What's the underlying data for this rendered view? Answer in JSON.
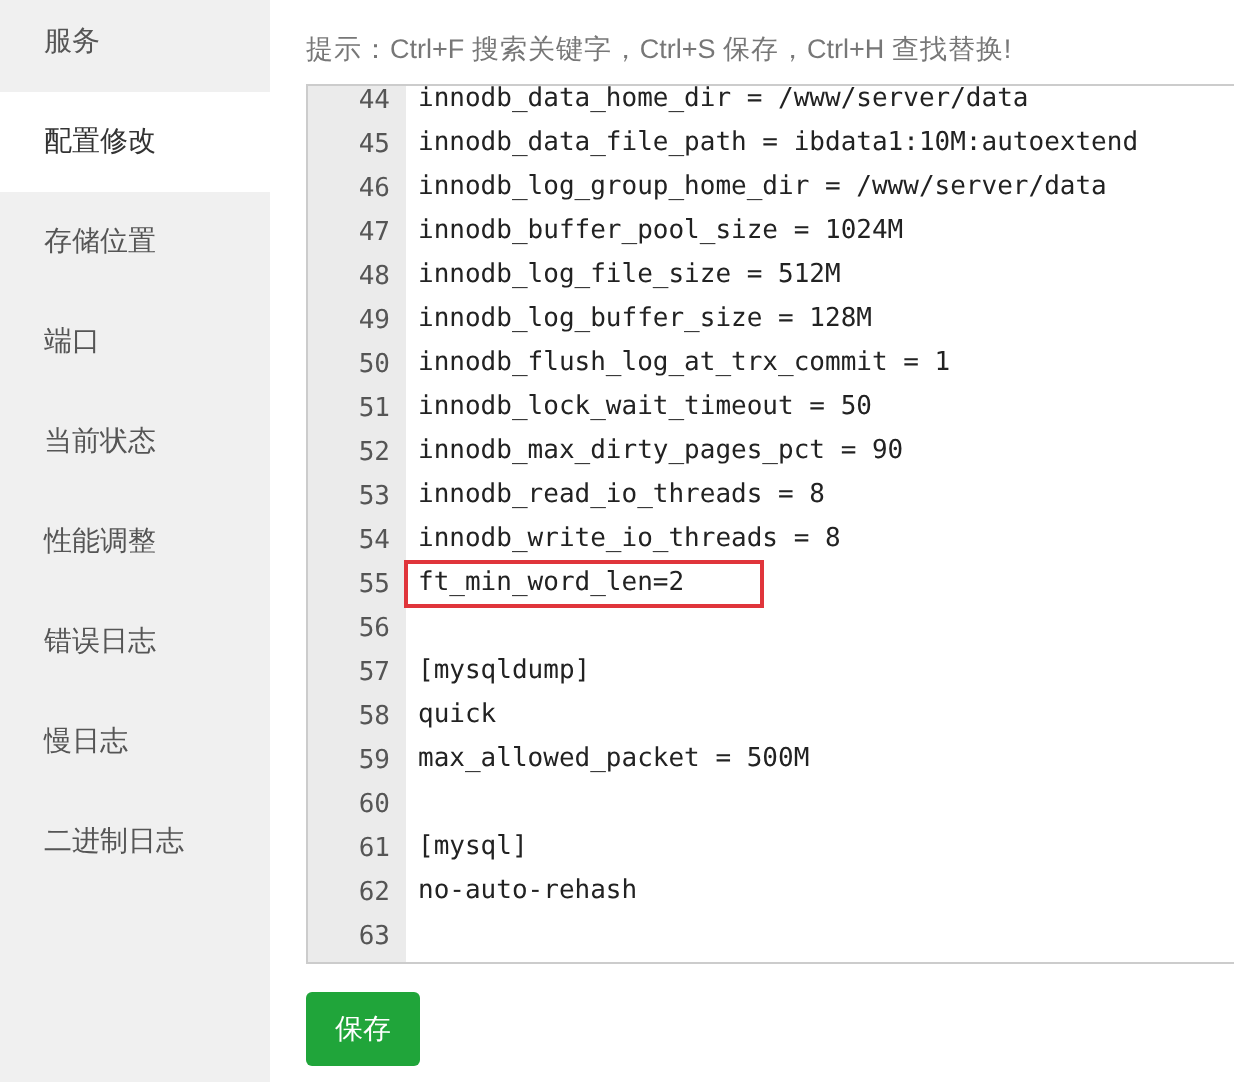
{
  "sidebar": {
    "items": [
      {
        "label": "服务",
        "selected": false
      },
      {
        "label": "配置修改",
        "selected": true
      },
      {
        "label": "存储位置",
        "selected": false
      },
      {
        "label": "端口",
        "selected": false
      },
      {
        "label": "当前状态",
        "selected": false
      },
      {
        "label": "性能调整",
        "selected": false
      },
      {
        "label": "错误日志",
        "selected": false
      },
      {
        "label": "慢日志",
        "selected": false
      },
      {
        "label": "二进制日志",
        "selected": false
      }
    ]
  },
  "hint": "提示：Ctrl+F 搜索关键字，Ctrl+S 保存，Ctrl+H 查找替换!",
  "editor": {
    "lines": [
      {
        "number": "44",
        "text": "innodb_data_home_dir = /www/server/data",
        "highlighted": false
      },
      {
        "number": "45",
        "text": "innodb_data_file_path = ibdata1:10M:autoextend",
        "highlighted": false
      },
      {
        "number": "46",
        "text": "innodb_log_group_home_dir = /www/server/data",
        "highlighted": false
      },
      {
        "number": "47",
        "text": "innodb_buffer_pool_size = 1024M",
        "highlighted": false
      },
      {
        "number": "48",
        "text": "innodb_log_file_size = 512M",
        "highlighted": false
      },
      {
        "number": "49",
        "text": "innodb_log_buffer_size = 128M",
        "highlighted": false
      },
      {
        "number": "50",
        "text": "innodb_flush_log_at_trx_commit = 1",
        "highlighted": false
      },
      {
        "number": "51",
        "text": "innodb_lock_wait_timeout = 50",
        "highlighted": false
      },
      {
        "number": "52",
        "text": "innodb_max_dirty_pages_pct = 90",
        "highlighted": false
      },
      {
        "number": "53",
        "text": "innodb_read_io_threads = 8",
        "highlighted": false
      },
      {
        "number": "54",
        "text": "innodb_write_io_threads = 8",
        "highlighted": false
      },
      {
        "number": "55",
        "text": "ft_min_word_len=2",
        "highlighted": true
      },
      {
        "number": "56",
        "highlighted": false
      },
      {
        "number": "57",
        "text": "[mysqldump]",
        "highlighted": false
      },
      {
        "number": "58",
        "text": "quick",
        "highlighted": false
      },
      {
        "number": "59",
        "text": "max_allowed_packet = 500M",
        "highlighted": false
      },
      {
        "number": "60",
        "highlighted": false
      },
      {
        "number": "61",
        "text": "[mysql]",
        "highlighted": false
      },
      {
        "number": "62",
        "text": "no-auto-rehash",
        "highlighted": false
      },
      {
        "number": "63",
        "highlighted": false
      }
    ]
  },
  "save_button": "保存"
}
